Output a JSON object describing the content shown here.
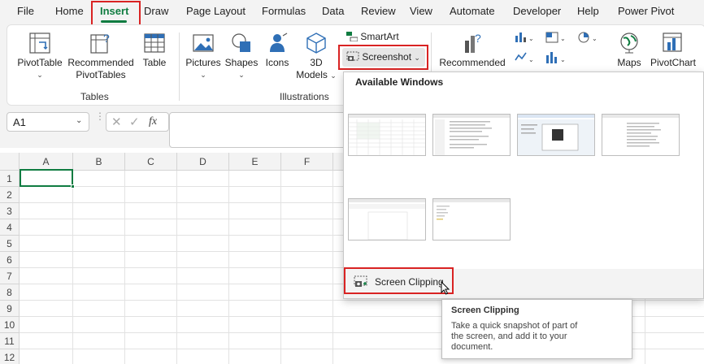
{
  "menu": {
    "tabs": [
      "File",
      "Home",
      "Insert",
      "Draw",
      "Page Layout",
      "Formulas",
      "Data",
      "Review",
      "View",
      "Automate",
      "Developer",
      "Help",
      "Power Pivot"
    ],
    "active_tab": "Insert"
  },
  "ribbon": {
    "pivottable": "PivotTable",
    "recommended_pivottables_1": "Recommended",
    "recommended_pivottables_2": "PivotTables",
    "table": "Table",
    "pictures": "Pictures",
    "shapes": "Shapes",
    "icons": "Icons",
    "models_1": "3D",
    "models_2": "Models",
    "smartart": "SmartArt",
    "screenshot": "Screenshot",
    "recommended_charts": "Recommended",
    "maps": "Maps",
    "pivotchart": "PivotChart",
    "group_tables": "Tables",
    "group_illustrations": "Illustrations"
  },
  "formula_bar": {
    "name_box": "A1",
    "fx": "fx",
    "formula": ""
  },
  "grid": {
    "columns": [
      "A",
      "B",
      "C",
      "D",
      "E",
      "F"
    ],
    "rows": [
      "1",
      "2",
      "3",
      "4",
      "5",
      "6",
      "7",
      "8",
      "9",
      "10",
      "11",
      "12"
    ],
    "active_cell": "A1"
  },
  "screenshot_menu": {
    "title": "Available Windows",
    "window_count": 6,
    "screen_clipping": "Screen Clipping"
  },
  "tooltip": {
    "title": "Screen Clipping",
    "body": "Take a quick snapshot of part of\nthe screen, and add it to your\ndocument."
  },
  "colors": {
    "accent_green": "#107c41",
    "highlight_red": "#d92323",
    "icon_blue": "#2f6fb6"
  }
}
